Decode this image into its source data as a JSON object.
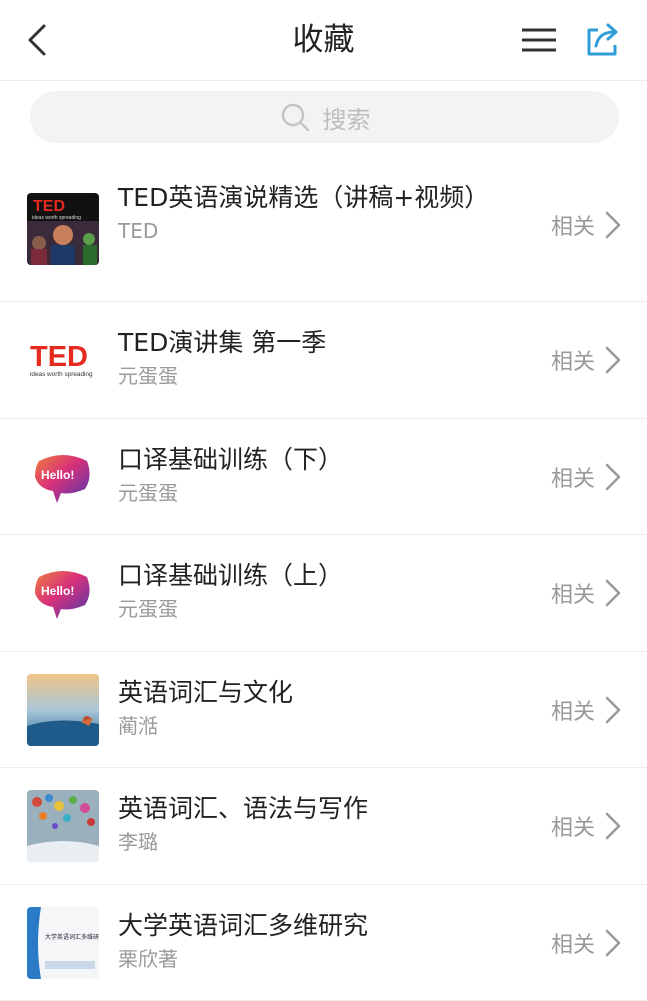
{
  "header": {
    "title": "收藏"
  },
  "search": {
    "placeholder": "搜索"
  },
  "items": [
    {
      "title": "TED英语演说精选（讲稿+视频）",
      "author": "TED",
      "related": "相关"
    },
    {
      "title": "TED演讲集 第一季",
      "author": "元蛋蛋",
      "related": "相关"
    },
    {
      "title": "口译基础训练（下）",
      "author": "元蛋蛋",
      "related": "相关"
    },
    {
      "title": "口译基础训练（上）",
      "author": "元蛋蛋",
      "related": "相关"
    },
    {
      "title": "英语词汇与文化",
      "author": "蔺湉",
      "related": "相关"
    },
    {
      "title": "英语词汇、语法与写作",
      "author": "李璐",
      "related": "相关"
    },
    {
      "title": "大学英语词汇多维研究",
      "author": "栗欣著",
      "related": "相关"
    }
  ],
  "thumbs": {
    "ted_logo_text": "TED",
    "ted_tagline": "ideas worth spreading",
    "hello_text": "Hello!",
    "book_cover_title": "大学英语词汇多维研究"
  },
  "colors": {
    "accent": "#2f9ed8"
  }
}
